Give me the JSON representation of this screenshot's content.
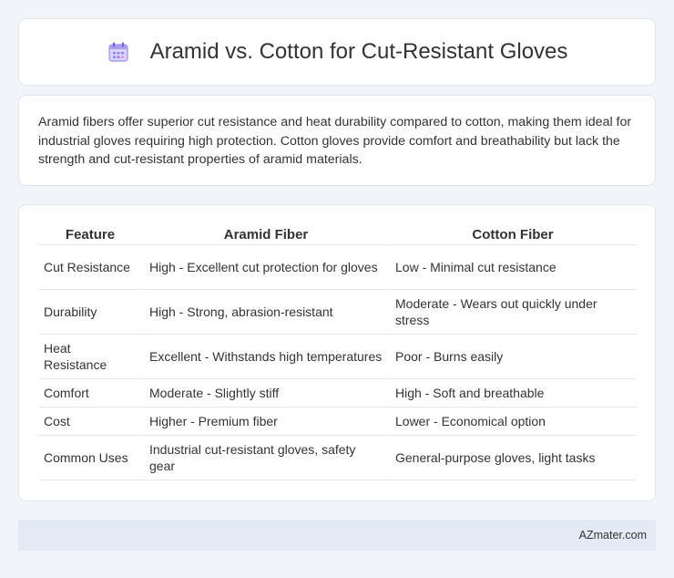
{
  "header": {
    "title": "Aramid vs. Cotton for Cut-Resistant Gloves",
    "icon": "calendar-icon"
  },
  "intro": {
    "text": "Aramid fibers offer superior cut resistance and heat durability compared to cotton, making them ideal for industrial gloves requiring high protection. Cotton gloves provide comfort and breathability but lack the strength and cut-resistant properties of aramid materials."
  },
  "table": {
    "headers": [
      "Feature",
      "Aramid Fiber",
      "Cotton Fiber"
    ],
    "rows": [
      [
        "Cut Resistance",
        "High - Excellent cut protection for gloves",
        "Low - Minimal cut resistance"
      ],
      [
        "Durability",
        "High - Strong, abrasion-resistant",
        "Moderate - Wears out quickly under stress"
      ],
      [
        "Heat Resistance",
        "Excellent - Withstands high temperatures",
        "Poor - Burns easily"
      ],
      [
        "Comfort",
        "Moderate - Slightly stiff",
        "High - Soft and breathable"
      ],
      [
        "Cost",
        "Higher - Premium fiber",
        "Lower - Economical option"
      ],
      [
        "Common Uses",
        "Industrial cut-resistant gloves, safety gear",
        "General-purpose gloves, light tasks"
      ]
    ]
  },
  "footer": {
    "brand": "AZmater.com"
  },
  "colors": {
    "background": "#f1f4f8",
    "card": "#ffffff",
    "footer": "#e3e9f5",
    "icon_accent": "#8a7fe8"
  }
}
